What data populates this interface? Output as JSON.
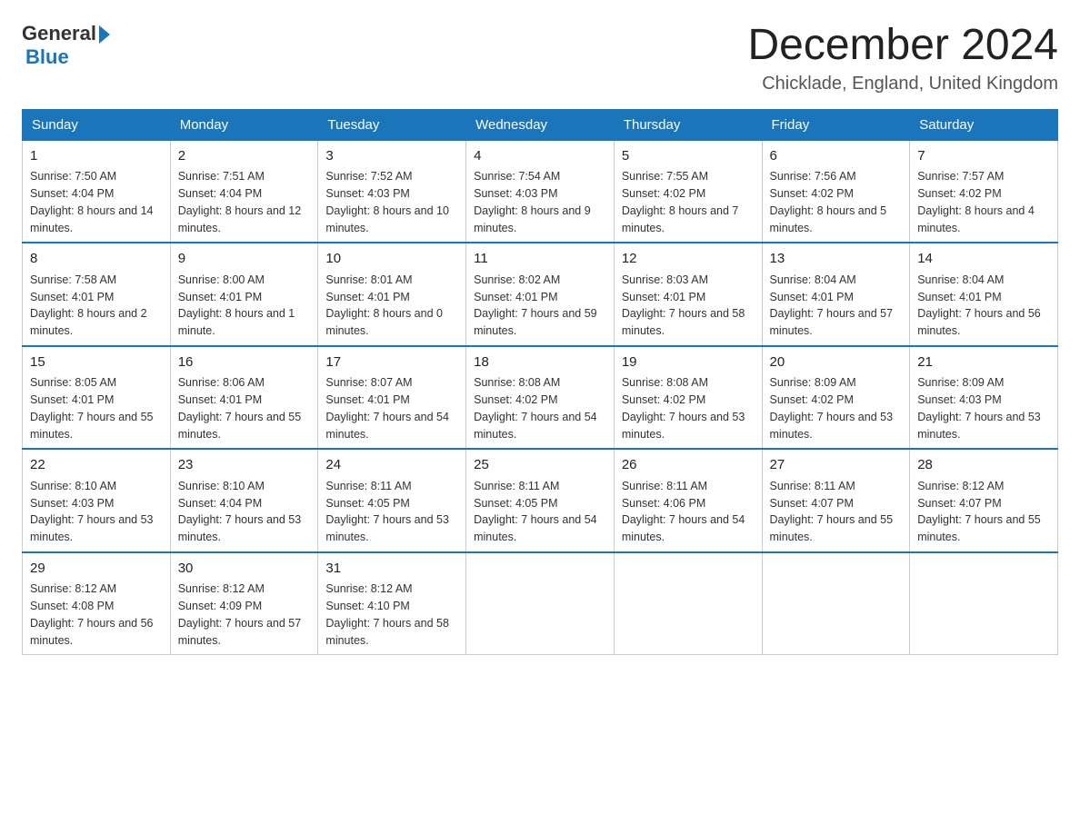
{
  "header": {
    "logo_general": "General",
    "logo_blue": "Blue",
    "month_title": "December 2024",
    "location": "Chicklade, England, United Kingdom"
  },
  "days_of_week": [
    "Sunday",
    "Monday",
    "Tuesday",
    "Wednesday",
    "Thursday",
    "Friday",
    "Saturday"
  ],
  "weeks": [
    [
      {
        "day": "1",
        "sunrise": "7:50 AM",
        "sunset": "4:04 PM",
        "daylight": "8 hours and 14 minutes."
      },
      {
        "day": "2",
        "sunrise": "7:51 AM",
        "sunset": "4:04 PM",
        "daylight": "8 hours and 12 minutes."
      },
      {
        "day": "3",
        "sunrise": "7:52 AM",
        "sunset": "4:03 PM",
        "daylight": "8 hours and 10 minutes."
      },
      {
        "day": "4",
        "sunrise": "7:54 AM",
        "sunset": "4:03 PM",
        "daylight": "8 hours and 9 minutes."
      },
      {
        "day": "5",
        "sunrise": "7:55 AM",
        "sunset": "4:02 PM",
        "daylight": "8 hours and 7 minutes."
      },
      {
        "day": "6",
        "sunrise": "7:56 AM",
        "sunset": "4:02 PM",
        "daylight": "8 hours and 5 minutes."
      },
      {
        "day": "7",
        "sunrise": "7:57 AM",
        "sunset": "4:02 PM",
        "daylight": "8 hours and 4 minutes."
      }
    ],
    [
      {
        "day": "8",
        "sunrise": "7:58 AM",
        "sunset": "4:01 PM",
        "daylight": "8 hours and 2 minutes."
      },
      {
        "day": "9",
        "sunrise": "8:00 AM",
        "sunset": "4:01 PM",
        "daylight": "8 hours and 1 minute."
      },
      {
        "day": "10",
        "sunrise": "8:01 AM",
        "sunset": "4:01 PM",
        "daylight": "8 hours and 0 minutes."
      },
      {
        "day": "11",
        "sunrise": "8:02 AM",
        "sunset": "4:01 PM",
        "daylight": "7 hours and 59 minutes."
      },
      {
        "day": "12",
        "sunrise": "8:03 AM",
        "sunset": "4:01 PM",
        "daylight": "7 hours and 58 minutes."
      },
      {
        "day": "13",
        "sunrise": "8:04 AM",
        "sunset": "4:01 PM",
        "daylight": "7 hours and 57 minutes."
      },
      {
        "day": "14",
        "sunrise": "8:04 AM",
        "sunset": "4:01 PM",
        "daylight": "7 hours and 56 minutes."
      }
    ],
    [
      {
        "day": "15",
        "sunrise": "8:05 AM",
        "sunset": "4:01 PM",
        "daylight": "7 hours and 55 minutes."
      },
      {
        "day": "16",
        "sunrise": "8:06 AM",
        "sunset": "4:01 PM",
        "daylight": "7 hours and 55 minutes."
      },
      {
        "day": "17",
        "sunrise": "8:07 AM",
        "sunset": "4:01 PM",
        "daylight": "7 hours and 54 minutes."
      },
      {
        "day": "18",
        "sunrise": "8:08 AM",
        "sunset": "4:02 PM",
        "daylight": "7 hours and 54 minutes."
      },
      {
        "day": "19",
        "sunrise": "8:08 AM",
        "sunset": "4:02 PM",
        "daylight": "7 hours and 53 minutes."
      },
      {
        "day": "20",
        "sunrise": "8:09 AM",
        "sunset": "4:02 PM",
        "daylight": "7 hours and 53 minutes."
      },
      {
        "day": "21",
        "sunrise": "8:09 AM",
        "sunset": "4:03 PM",
        "daylight": "7 hours and 53 minutes."
      }
    ],
    [
      {
        "day": "22",
        "sunrise": "8:10 AM",
        "sunset": "4:03 PM",
        "daylight": "7 hours and 53 minutes."
      },
      {
        "day": "23",
        "sunrise": "8:10 AM",
        "sunset": "4:04 PM",
        "daylight": "7 hours and 53 minutes."
      },
      {
        "day": "24",
        "sunrise": "8:11 AM",
        "sunset": "4:05 PM",
        "daylight": "7 hours and 53 minutes."
      },
      {
        "day": "25",
        "sunrise": "8:11 AM",
        "sunset": "4:05 PM",
        "daylight": "7 hours and 54 minutes."
      },
      {
        "day": "26",
        "sunrise": "8:11 AM",
        "sunset": "4:06 PM",
        "daylight": "7 hours and 54 minutes."
      },
      {
        "day": "27",
        "sunrise": "8:11 AM",
        "sunset": "4:07 PM",
        "daylight": "7 hours and 55 minutes."
      },
      {
        "day": "28",
        "sunrise": "8:12 AM",
        "sunset": "4:07 PM",
        "daylight": "7 hours and 55 minutes."
      }
    ],
    [
      {
        "day": "29",
        "sunrise": "8:12 AM",
        "sunset": "4:08 PM",
        "daylight": "7 hours and 56 minutes."
      },
      {
        "day": "30",
        "sunrise": "8:12 AM",
        "sunset": "4:09 PM",
        "daylight": "7 hours and 57 minutes."
      },
      {
        "day": "31",
        "sunrise": "8:12 AM",
        "sunset": "4:10 PM",
        "daylight": "7 hours and 58 minutes."
      },
      null,
      null,
      null,
      null
    ]
  ]
}
